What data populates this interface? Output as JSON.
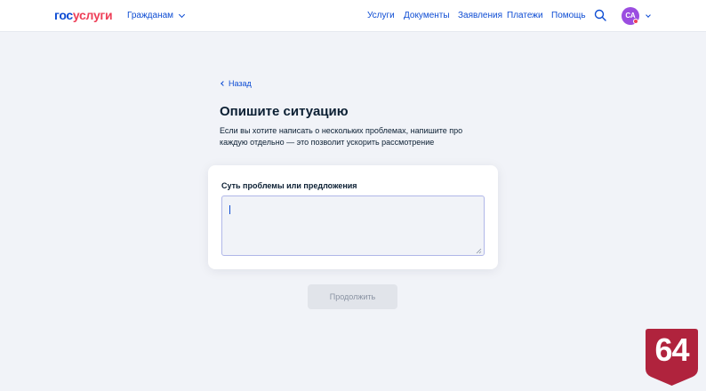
{
  "header": {
    "logo_part1": "гос",
    "logo_part2": "услуги",
    "role_selector": "Гражданам",
    "nav": [
      "Услуги",
      "Документы",
      "Заявления",
      "Платежи",
      "Помощь"
    ],
    "avatar_initials": "СА",
    "colors": {
      "brand_blue": "#0d4cd3",
      "brand_red": "#ee3f58",
      "avatar": "#9b4de0"
    }
  },
  "content": {
    "back_label": "Назад",
    "title": "Опишите ситуацию",
    "description": "Если вы хотите написать о нескольких проблемах, напишите про каждую отдельно — это позволит ускорить рассмотрение",
    "field_label": "Суть проблемы или предложения",
    "field_value": "",
    "continue_label": "Продолжить"
  },
  "badge": {
    "text": "64",
    "color": "#b0233d"
  }
}
